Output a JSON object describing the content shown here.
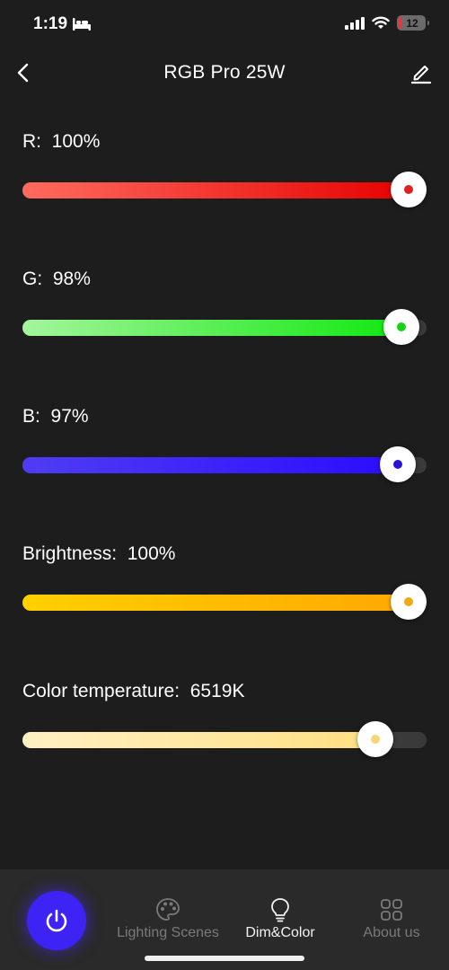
{
  "status_bar": {
    "time": "1:19",
    "battery_level": "12",
    "battery_color": "#e23b3b"
  },
  "header": {
    "title": "RGB Pro 25W",
    "back_icon": "chevron-left-icon",
    "edit_icon": "pencil-icon"
  },
  "sliders": [
    {
      "key": "r",
      "label": "R:  100%",
      "value_percent": 100,
      "fill_from": "#ff6b5e",
      "fill_to": "#e60000",
      "dot_color": "#e02020"
    },
    {
      "key": "g",
      "label": "G:  98%",
      "value_percent": 98,
      "fill_from": "#a4f59c",
      "fill_to": "#0fe80f",
      "dot_color": "#15d315"
    },
    {
      "key": "b",
      "label": "B:  97%",
      "value_percent": 97,
      "fill_from": "#4f3df2",
      "fill_to": "#2a0cff",
      "dot_color": "#2a13d6"
    },
    {
      "key": "brightness",
      "label": "Brightness:  100%",
      "value_percent": 100,
      "fill_from": "#ffd000",
      "fill_to": "#ffa800",
      "dot_color": "#f0a818"
    },
    {
      "key": "color_temp",
      "label": "Color temperature:  6519K",
      "value_percent": 91,
      "fill_from": "#fff0c4",
      "fill_to": "#ffe080",
      "dot_color": "#f7d774"
    }
  ],
  "bottom_nav": {
    "power_icon": "power-icon",
    "tabs": [
      {
        "label": "Lighting Scenes",
        "icon": "palette-icon",
        "active": false
      },
      {
        "label": "Dim&Color",
        "icon": "lightbulb-icon",
        "active": true
      },
      {
        "label": "About us",
        "icon": "grid-icon",
        "active": false
      }
    ]
  }
}
